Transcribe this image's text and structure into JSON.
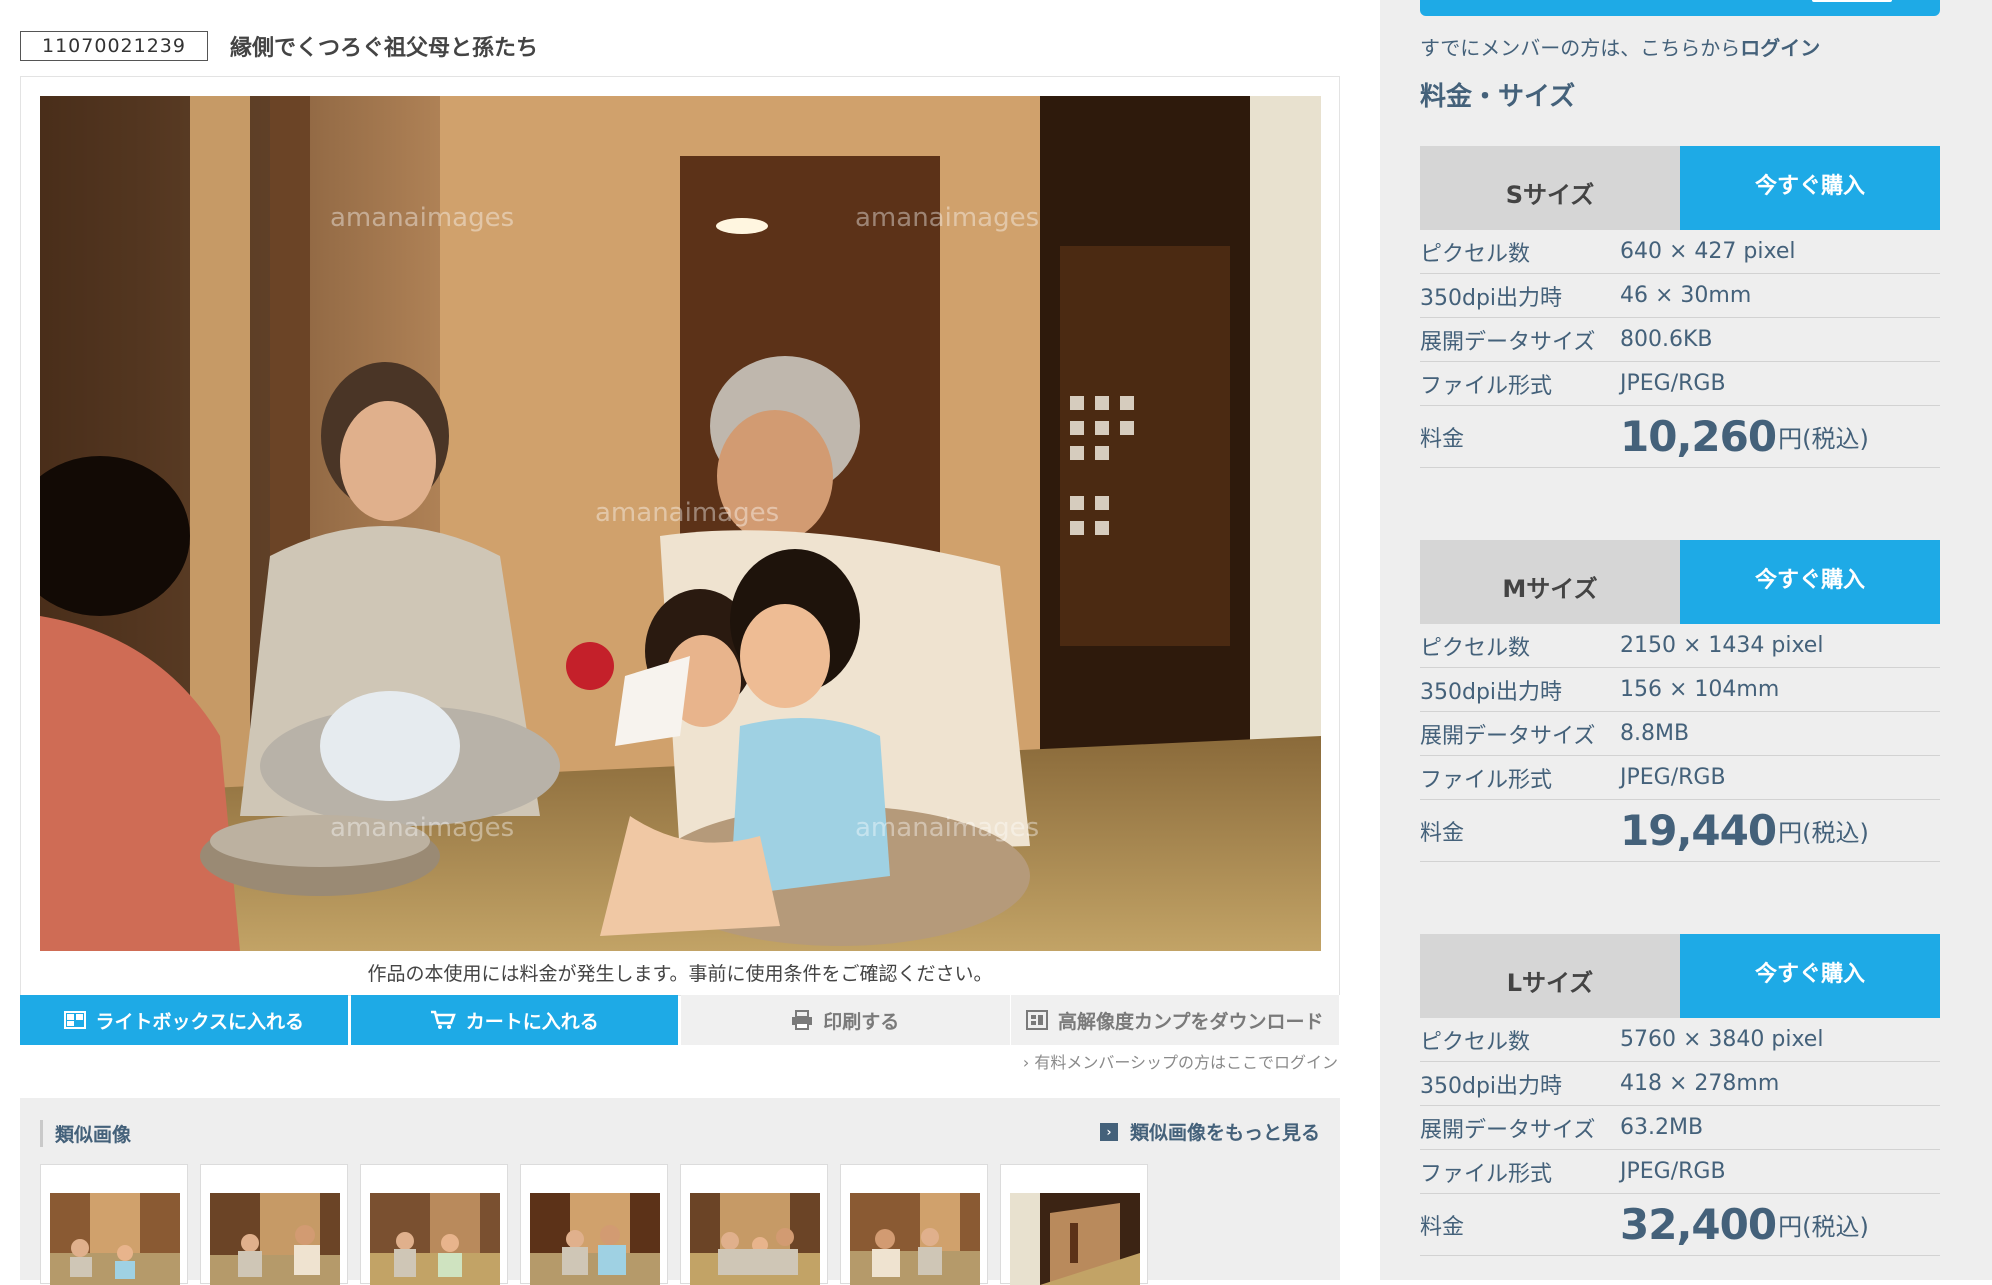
{
  "image": {
    "id": "11070021239",
    "title": "縁側でくつろぐ祖父母と孫たち",
    "watermark": "amanaimages",
    "notice": "作品の本使用には料金が発生します。事前に使用条件をご確認ください。"
  },
  "actions": {
    "lightbox": "ライトボックスに入れる",
    "cart": "カートに入れる",
    "print": "印刷する",
    "comp": "高解像度カンプをダウンロード",
    "member_link": "› 有料メンバーシップの方はここでログイン"
  },
  "similar": {
    "heading": "類似画像",
    "more": "類似画像をもっと見る",
    "thumb_count": 7
  },
  "sidebar": {
    "login_prefix": "すでにメンバーの方は、こちらから",
    "login_link": "ログイン",
    "section_title": "料金・サイズ",
    "sizes": [
      {
        "name": "Sサイズ",
        "buy": "今すぐ購入",
        "pixels_label": "ピクセル数",
        "pixels": "640 × 427 pixel",
        "print_label": "350dpi出力時",
        "print": "46 × 30mm",
        "data_label": "展開データサイズ",
        "data": "800.6KB",
        "format_label": "ファイル形式",
        "format": "JPEG/RGB",
        "price_label": "料金",
        "price": "10,260",
        "price_unit": "円(税込)"
      },
      {
        "name": "Mサイズ",
        "buy": "今すぐ購入",
        "pixels_label": "ピクセル数",
        "pixels": "2150 × 1434 pixel",
        "print_label": "350dpi出力時",
        "print": "156 × 104mm",
        "data_label": "展開データサイズ",
        "data": "8.8MB",
        "format_label": "ファイル形式",
        "format": "JPEG/RGB",
        "price_label": "料金",
        "price": "19,440",
        "price_unit": "円(税込)"
      },
      {
        "name": "Lサイズ",
        "buy": "今すぐ購入",
        "pixels_label": "ピクセル数",
        "pixels": "5760 × 3840 pixel",
        "print_label": "350dpi出力時",
        "print": "418 × 278mm",
        "data_label": "展開データサイズ",
        "data": "63.2MB",
        "format_label": "ファイル形式",
        "format": "JPEG/RGB",
        "price_label": "料金",
        "price": "32,400",
        "price_unit": "円(税込)"
      }
    ]
  },
  "colors": {
    "accent": "#1eaae6",
    "text_blue": "#44617a",
    "sidebar_bg": "#eeeeee"
  }
}
